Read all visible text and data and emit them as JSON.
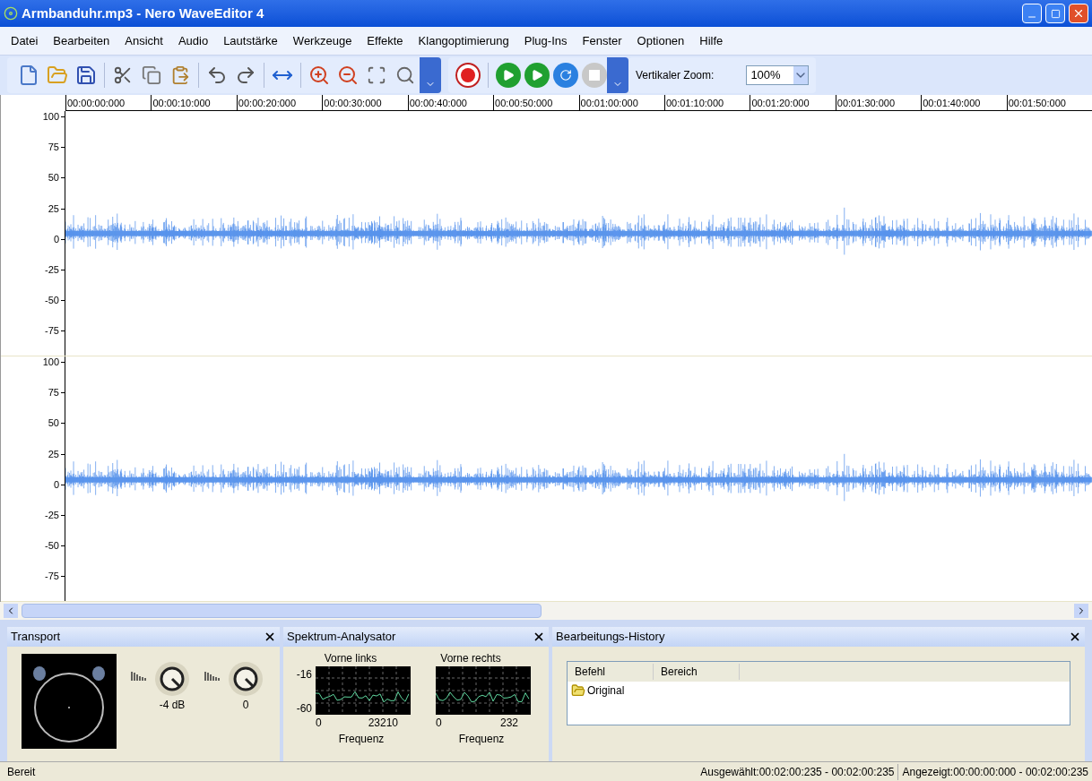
{
  "window": {
    "title": "Armbanduhr.mp3 - Nero WaveEditor 4"
  },
  "menu": [
    "Datei",
    "Bearbeiten",
    "Ansicht",
    "Audio",
    "Lautstärke",
    "Werkzeuge",
    "Effekte",
    "Klangoptimierung",
    "Plug-Ins",
    "Fenster",
    "Optionen",
    "Hilfe"
  ],
  "toolbar": {
    "zoom_label": "Vertikaler Zoom:",
    "zoom_value": "100%"
  },
  "ruler": [
    "00:00:00:000",
    "00:00:10:000",
    "00:00:20:000",
    "00:00:30:000",
    "00:00:40:000",
    "00:00:50:000",
    "00:01:00:000",
    "00:01:10:000",
    "00:01:20:000",
    "00:01:30:000",
    "00:01:40:000",
    "00:01:50:000"
  ],
  "channels": [
    {
      "axis": [
        "100",
        "75",
        "50",
        "25",
        "0",
        "-25",
        "-50",
        "-75"
      ]
    },
    {
      "axis": [
        "100",
        "75",
        "50",
        "25",
        "0",
        "-25",
        "-50",
        "-75"
      ]
    }
  ],
  "transport": {
    "title": "Transport",
    "knobs": [
      "-4 dB",
      "0"
    ]
  },
  "spectrum": {
    "title": "Spektrum-Analysator",
    "graphs": [
      {
        "label": "Vorne links",
        "ymax": "-16",
        "ymin": "-60",
        "xmin": "0",
        "xmax": "23210",
        "xlabel": "Frequenz"
      },
      {
        "label": "Vorne rechts",
        "xmin": "0",
        "xmax": "232",
        "xlabel": "Frequenz"
      }
    ]
  },
  "history": {
    "title": "Bearbeitungs-History",
    "columns": [
      "Befehl",
      "Bereich"
    ],
    "rows": [
      "Original"
    ]
  },
  "status_bar": {
    "left": "Bereit",
    "selected": "Ausgewählt:00:02:00:235 - 00:02:00:235",
    "shown": "Angezeigt:00:00:00:000 - 00:02:00:235"
  }
}
